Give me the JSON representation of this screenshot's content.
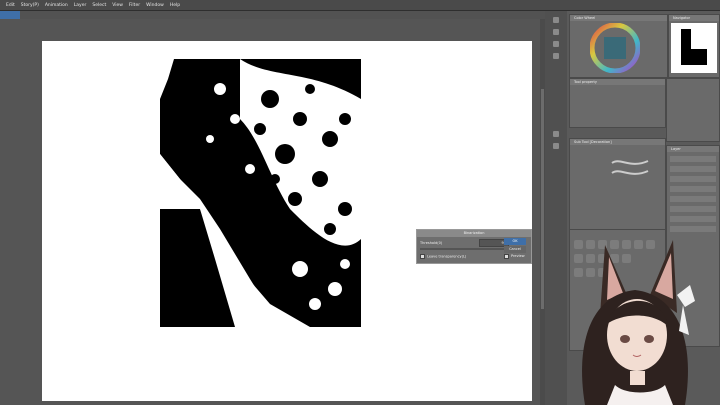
{
  "menu": [
    "Edit",
    "Story(P)",
    "Animation",
    "Layer",
    "Select",
    "View",
    "Filter",
    "Window",
    "Help"
  ],
  "panels": {
    "color_wheel_title": "Color Wheel",
    "navigator_title": "Navigator",
    "tool_property_title": "Tool property",
    "sub_tool_title": "Sub Tool [Decoration]",
    "layer_title": "Layer"
  },
  "dialog": {
    "title": "Binarization",
    "threshold_label": "Threshold(0)",
    "threshold_value": "92",
    "ok_label": "OK",
    "cancel_label": "Cancel",
    "preview_label": "Preview",
    "leave_transparency_label": "Leave transparency(L)"
  },
  "colors": {
    "accent": "#3f6fa8",
    "bg": "#3a3a3a",
    "canvas": "#ffffff"
  }
}
